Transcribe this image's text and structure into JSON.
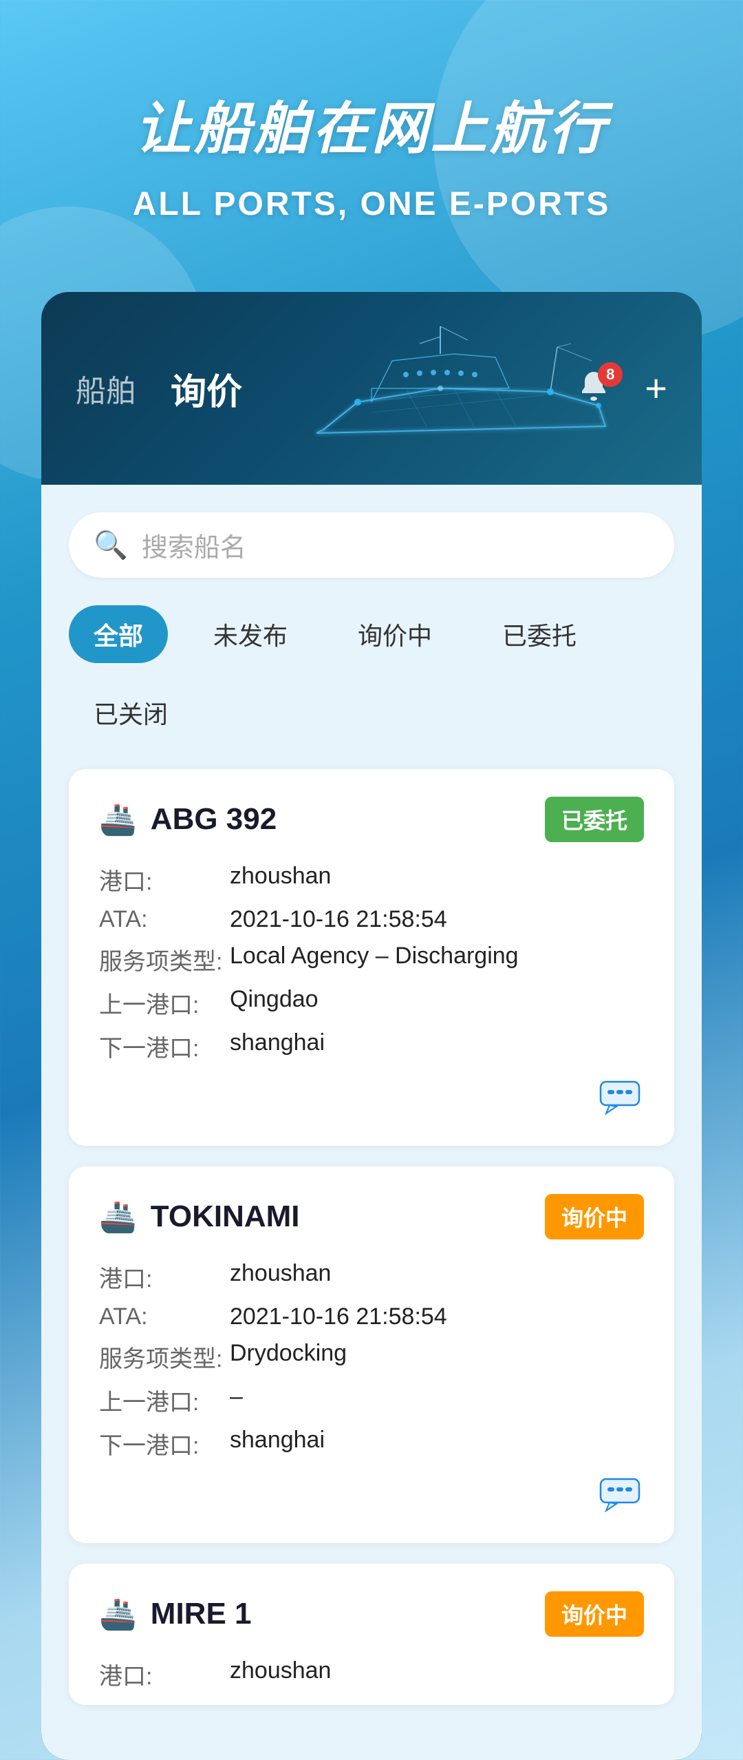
{
  "hero": {
    "title": "让船舶在网上航行",
    "subtitle": "ALL PORTS, ONE E-PORTS"
  },
  "card": {
    "nav": {
      "tab1": "船舶",
      "tab2": "询价"
    },
    "bell_badge": "8",
    "plus_label": "+",
    "search_placeholder": "搜索船名"
  },
  "filters": [
    {
      "label": "全部",
      "active": true
    },
    {
      "label": "未发布",
      "active": false
    },
    {
      "label": "询价中",
      "active": false
    },
    {
      "label": "已委托",
      "active": false
    },
    {
      "label": "已关闭",
      "active": false
    }
  ],
  "ships": [
    {
      "name": "ABG 392",
      "status": "已委托",
      "status_type": "commissioned",
      "fields": [
        {
          "label": "港口:",
          "value": "zhoushan"
        },
        {
          "label": "ATA:",
          "value": "2021-10-16  21:58:54"
        },
        {
          "label": "服务项类型:",
          "value": "Local Agency – Discharging"
        },
        {
          "label": "上一港口:",
          "value": "Qingdao"
        },
        {
          "label": "下一港口:",
          "value": "shanghai"
        }
      ]
    },
    {
      "name": "TOKINAMI",
      "status": "询价中",
      "status_type": "inquiring",
      "fields": [
        {
          "label": "港口:",
          "value": "zhoushan"
        },
        {
          "label": "ATA:",
          "value": "2021-10-16  21:58:54"
        },
        {
          "label": "服务项类型:",
          "value": "Drydocking"
        },
        {
          "label": "上一港口:",
          "value": "–"
        },
        {
          "label": "下一港口:",
          "value": "shanghai"
        }
      ]
    },
    {
      "name": "MIRE 1",
      "status": "询价中",
      "status_type": "inquiring",
      "fields": [
        {
          "label": "港口:",
          "value": "zhoushan"
        }
      ],
      "partial": true
    }
  ],
  "icons": {
    "search": "🔍",
    "bell": "🔔",
    "chat": "💬",
    "ship": "🚢"
  }
}
